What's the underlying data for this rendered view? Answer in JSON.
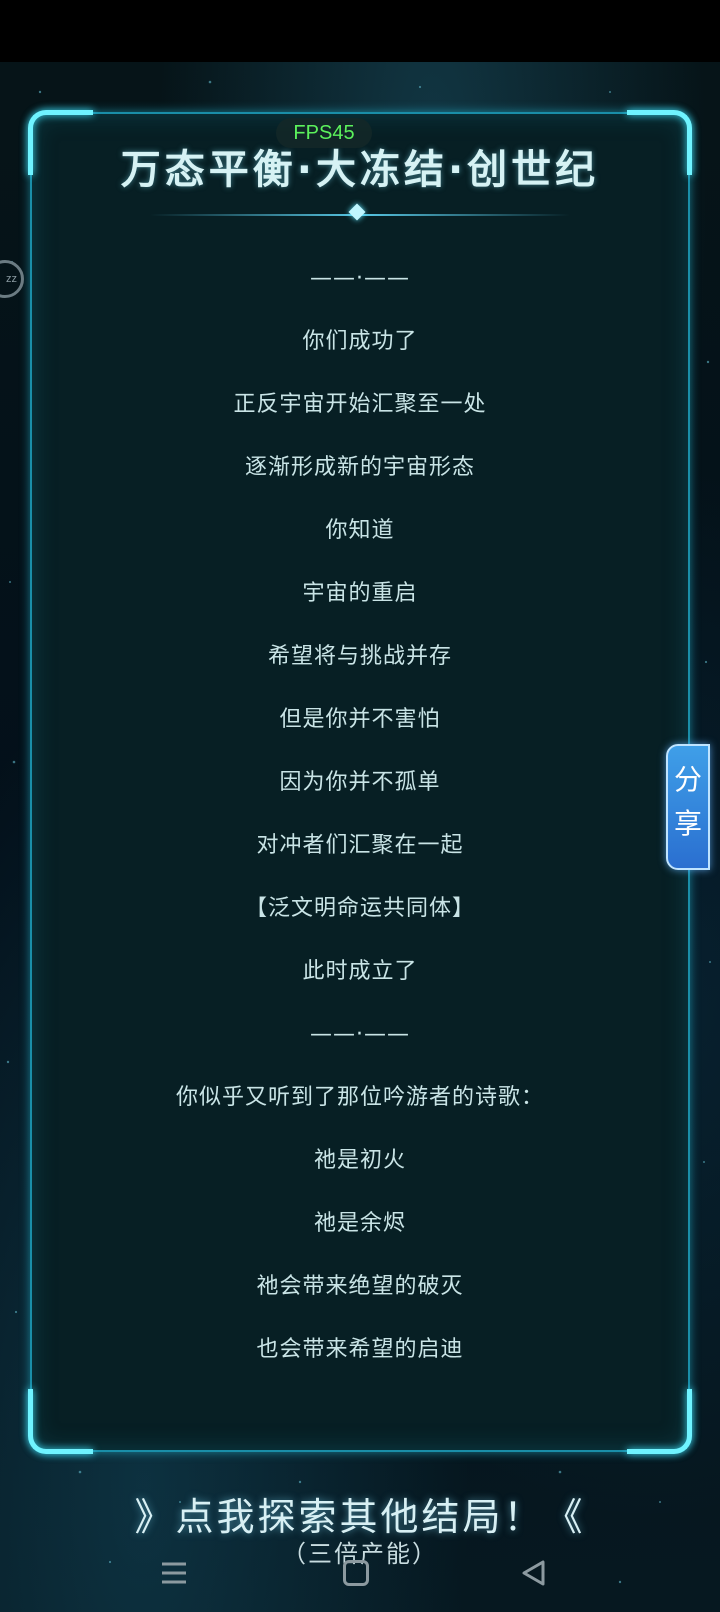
{
  "overlay": {
    "fps": "FPS45"
  },
  "panel": {
    "title": "万态平衡·大冻结·创世纪",
    "lines": [
      "——·——",
      "你们成功了",
      "正反宇宙开始汇聚至一处",
      "逐渐形成新的宇宙形态",
      "你知道",
      "宇宙的重启",
      "希望将与挑战并存",
      "但是你并不害怕",
      "因为你并不孤单",
      "对冲者们汇聚在一起",
      "【泛文明命运共同体】",
      "此时成立了",
      "——·——",
      "你似乎又听到了那位吟游者的诗歌：",
      "祂是初火",
      "祂是余烬",
      "祂会带来绝望的破灭",
      "也会带来希望的启迪"
    ]
  },
  "share": {
    "char1": "分",
    "char2": "享"
  },
  "footer": {
    "explore_label": "》点我探索其他结局！《",
    "explore_sub": "（三倍产能）"
  },
  "nav": {
    "menu_icon": "menu-icon",
    "home_icon": "home-icon",
    "back_icon": "back-icon"
  }
}
